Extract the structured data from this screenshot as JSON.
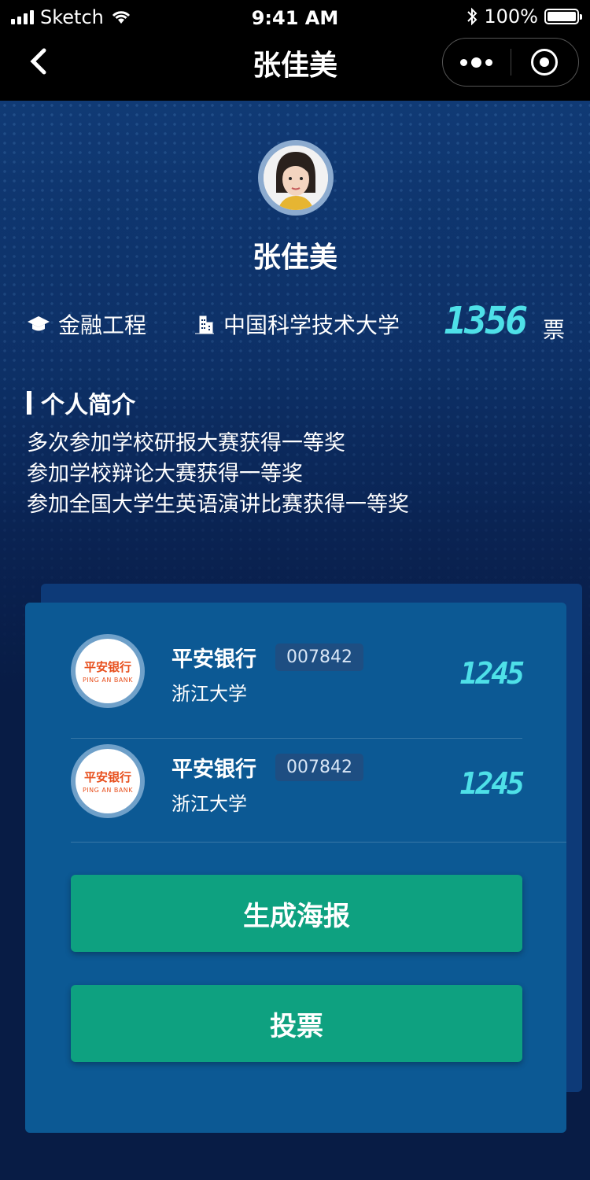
{
  "status_bar": {
    "carrier": "Sketch",
    "time": "9:41 AM",
    "battery": "100%"
  },
  "nav": {
    "title": "张佳美"
  },
  "profile": {
    "name": "张佳美",
    "major": "金融工程",
    "school": "中国科学技术大学",
    "votes": "1356",
    "votes_unit": "票"
  },
  "bio": {
    "title": "个人简介",
    "lines": [
      "多次参加学校研报大赛获得一等奖",
      "参加学校辩论大赛获得一等奖",
      "参加全国大学生英语演讲比赛获得一等奖"
    ]
  },
  "entries": [
    {
      "logo_cn": "平安银行",
      "logo_en": "PING AN BANK",
      "bank": "平安银行",
      "code": "007842",
      "school": "浙江大学",
      "votes": "1245"
    },
    {
      "logo_cn": "平安银行",
      "logo_en": "PING AN BANK",
      "bank": "平安银行",
      "code": "007842",
      "school": "浙江大学",
      "votes": "1245"
    }
  ],
  "buttons": {
    "poster": "生成海报",
    "vote": "投票"
  },
  "colors": {
    "accent_cyan": "#4ee0e8",
    "button_green": "#0ea180",
    "card_blue": "#0c5994"
  },
  "icons": {
    "back": "chevron-left-icon",
    "more": "more-dots-icon",
    "close": "target-icon",
    "major": "graduation-cap-icon",
    "school": "building-icon"
  }
}
